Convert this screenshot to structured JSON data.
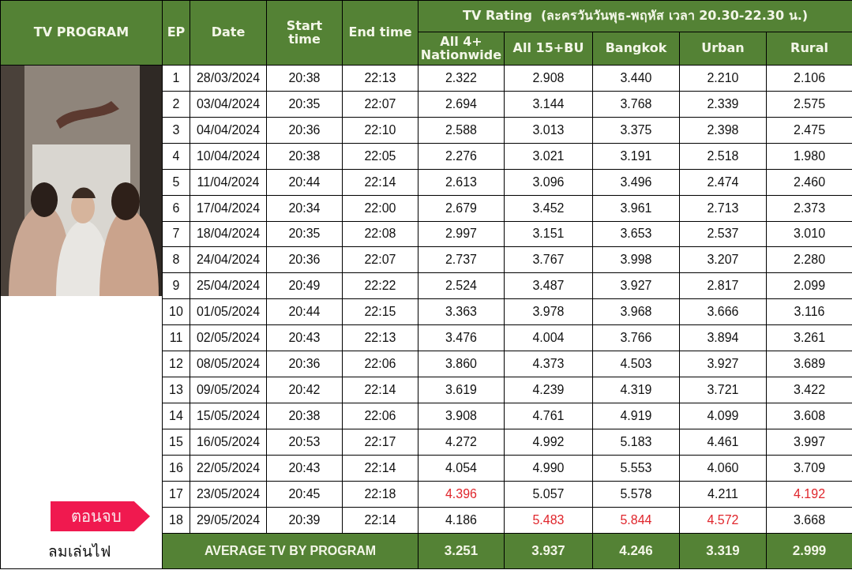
{
  "header": {
    "program": "TV PROGRAM",
    "ep": "EP",
    "date": "Date",
    "start": "Start time",
    "end": "End time",
    "rating_title": "TV Rating  (ละครวันวันพุธ-พฤหัส เวลา 20.30-22.30 น.)",
    "audiences": [
      "All 4+ Nationwide",
      "All 15+BU",
      "Bangkok",
      "Urban",
      "Rural"
    ]
  },
  "program": {
    "badge": "ตอนจบ",
    "title": "ลมเล่นไฟ"
  },
  "rows": [
    {
      "ep": "1",
      "date": "28/03/2024",
      "start": "20:38",
      "end": "22:13",
      "ratings": [
        {
          "value": "2.322",
          "highlighted": false
        },
        {
          "value": "2.908",
          "highlighted": false
        },
        {
          "value": "3.440",
          "highlighted": false
        },
        {
          "value": "2.210",
          "highlighted": false
        },
        {
          "value": "2.106",
          "highlighted": false
        }
      ]
    },
    {
      "ep": "2",
      "date": "03/04/2024",
      "start": "20:35",
      "end": "22:07",
      "ratings": [
        {
          "value": "2.694",
          "highlighted": false
        },
        {
          "value": "3.144",
          "highlighted": false
        },
        {
          "value": "3.768",
          "highlighted": false
        },
        {
          "value": "2.339",
          "highlighted": false
        },
        {
          "value": "2.575",
          "highlighted": false
        }
      ]
    },
    {
      "ep": "3",
      "date": "04/04/2024",
      "start": "20:36",
      "end": "22:10",
      "ratings": [
        {
          "value": "2.588",
          "highlighted": false
        },
        {
          "value": "3.013",
          "highlighted": false
        },
        {
          "value": "3.375",
          "highlighted": false
        },
        {
          "value": "2.398",
          "highlighted": false
        },
        {
          "value": "2.475",
          "highlighted": false
        }
      ]
    },
    {
      "ep": "4",
      "date": "10/04/2024",
      "start": "20:38",
      "end": "22:05",
      "ratings": [
        {
          "value": "2.276",
          "highlighted": false
        },
        {
          "value": "3.021",
          "highlighted": false
        },
        {
          "value": "3.191",
          "highlighted": false
        },
        {
          "value": "2.518",
          "highlighted": false
        },
        {
          "value": "1.980",
          "highlighted": false
        }
      ]
    },
    {
      "ep": "5",
      "date": "11/04/2024",
      "start": "20:44",
      "end": "22:14",
      "ratings": [
        {
          "value": "2.613",
          "highlighted": false
        },
        {
          "value": "3.096",
          "highlighted": false
        },
        {
          "value": "3.496",
          "highlighted": false
        },
        {
          "value": "2.474",
          "highlighted": false
        },
        {
          "value": "2.460",
          "highlighted": false
        }
      ]
    },
    {
      "ep": "6",
      "date": "17/04/2024",
      "start": "20:34",
      "end": "22:00",
      "ratings": [
        {
          "value": "2.679",
          "highlighted": false
        },
        {
          "value": "3.452",
          "highlighted": false
        },
        {
          "value": "3.961",
          "highlighted": false
        },
        {
          "value": "2.713",
          "highlighted": false
        },
        {
          "value": "2.373",
          "highlighted": false
        }
      ]
    },
    {
      "ep": "7",
      "date": "18/04/2024",
      "start": "20:35",
      "end": "22:08",
      "ratings": [
        {
          "value": "2.997",
          "highlighted": false
        },
        {
          "value": "3.151",
          "highlighted": false
        },
        {
          "value": "3.653",
          "highlighted": false
        },
        {
          "value": "2.537",
          "highlighted": false
        },
        {
          "value": "3.010",
          "highlighted": false
        }
      ]
    },
    {
      "ep": "8",
      "date": "24/04/2024",
      "start": "20:36",
      "end": "22:07",
      "ratings": [
        {
          "value": "2.737",
          "highlighted": false
        },
        {
          "value": "3.767",
          "highlighted": false
        },
        {
          "value": "3.998",
          "highlighted": false
        },
        {
          "value": "3.207",
          "highlighted": false
        },
        {
          "value": "2.280",
          "highlighted": false
        }
      ]
    },
    {
      "ep": "9",
      "date": "25/04/2024",
      "start": "20:49",
      "end": "22:22",
      "ratings": [
        {
          "value": "2.524",
          "highlighted": false
        },
        {
          "value": "3.487",
          "highlighted": false
        },
        {
          "value": "3.927",
          "highlighted": false
        },
        {
          "value": "2.817",
          "highlighted": false
        },
        {
          "value": "2.099",
          "highlighted": false
        }
      ]
    },
    {
      "ep": "10",
      "date": "01/05/2024",
      "start": "20:44",
      "end": "22:15",
      "ratings": [
        {
          "value": "3.363",
          "highlighted": false
        },
        {
          "value": "3.978",
          "highlighted": false
        },
        {
          "value": "3.968",
          "highlighted": false
        },
        {
          "value": "3.666",
          "highlighted": false
        },
        {
          "value": "3.116",
          "highlighted": false
        }
      ]
    },
    {
      "ep": "11",
      "date": "02/05/2024",
      "start": "20:43",
      "end": "22:13",
      "ratings": [
        {
          "value": "3.476",
          "highlighted": false
        },
        {
          "value": "4.004",
          "highlighted": false
        },
        {
          "value": "3.766",
          "highlighted": false
        },
        {
          "value": "3.894",
          "highlighted": false
        },
        {
          "value": "3.261",
          "highlighted": false
        }
      ]
    },
    {
      "ep": "12",
      "date": "08/05/2024",
      "start": "20:36",
      "end": "22:06",
      "ratings": [
        {
          "value": "3.860",
          "highlighted": false
        },
        {
          "value": "4.373",
          "highlighted": false
        },
        {
          "value": "4.503",
          "highlighted": false
        },
        {
          "value": "3.927",
          "highlighted": false
        },
        {
          "value": "3.689",
          "highlighted": false
        }
      ]
    },
    {
      "ep": "13",
      "date": "09/05/2024",
      "start": "20:42",
      "end": "22:14",
      "ratings": [
        {
          "value": "3.619",
          "highlighted": false
        },
        {
          "value": "4.239",
          "highlighted": false
        },
        {
          "value": "4.319",
          "highlighted": false
        },
        {
          "value": "3.721",
          "highlighted": false
        },
        {
          "value": "3.422",
          "highlighted": false
        }
      ]
    },
    {
      "ep": "14",
      "date": "15/05/2024",
      "start": "20:38",
      "end": "22:06",
      "ratings": [
        {
          "value": "3.908",
          "highlighted": false
        },
        {
          "value": "4.761",
          "highlighted": false
        },
        {
          "value": "4.919",
          "highlighted": false
        },
        {
          "value": "4.099",
          "highlighted": false
        },
        {
          "value": "3.608",
          "highlighted": false
        }
      ]
    },
    {
      "ep": "15",
      "date": "16/05/2024",
      "start": "20:53",
      "end": "22:17",
      "ratings": [
        {
          "value": "4.272",
          "highlighted": false
        },
        {
          "value": "4.992",
          "highlighted": false
        },
        {
          "value": "5.183",
          "highlighted": false
        },
        {
          "value": "4.461",
          "highlighted": false
        },
        {
          "value": "3.997",
          "highlighted": false
        }
      ]
    },
    {
      "ep": "16",
      "date": "22/05/2024",
      "start": "20:43",
      "end": "22:14",
      "ratings": [
        {
          "value": "4.054",
          "highlighted": false
        },
        {
          "value": "4.990",
          "highlighted": false
        },
        {
          "value": "5.553",
          "highlighted": false
        },
        {
          "value": "4.060",
          "highlighted": false
        },
        {
          "value": "3.709",
          "highlighted": false
        }
      ]
    },
    {
      "ep": "17",
      "date": "23/05/2024",
      "start": "20:45",
      "end": "22:18",
      "ratings": [
        {
          "value": "4.396",
          "highlighted": true
        },
        {
          "value": "5.057",
          "highlighted": false
        },
        {
          "value": "5.578",
          "highlighted": false
        },
        {
          "value": "4.211",
          "highlighted": false
        },
        {
          "value": "4.192",
          "highlighted": true
        }
      ]
    },
    {
      "ep": "18",
      "date": "29/05/2024",
      "start": "20:39",
      "end": "22:14",
      "ratings": [
        {
          "value": "4.186",
          "highlighted": false
        },
        {
          "value": "5.483",
          "highlighted": true
        },
        {
          "value": "5.844",
          "highlighted": true
        },
        {
          "value": "4.572",
          "highlighted": true
        },
        {
          "value": "3.668",
          "highlighted": false
        }
      ]
    }
  ],
  "average": {
    "label": "AVERAGE TV BY PROGRAM",
    "values": [
      "3.251",
      "3.937",
      "4.246",
      "3.319",
      "2.999"
    ]
  }
}
